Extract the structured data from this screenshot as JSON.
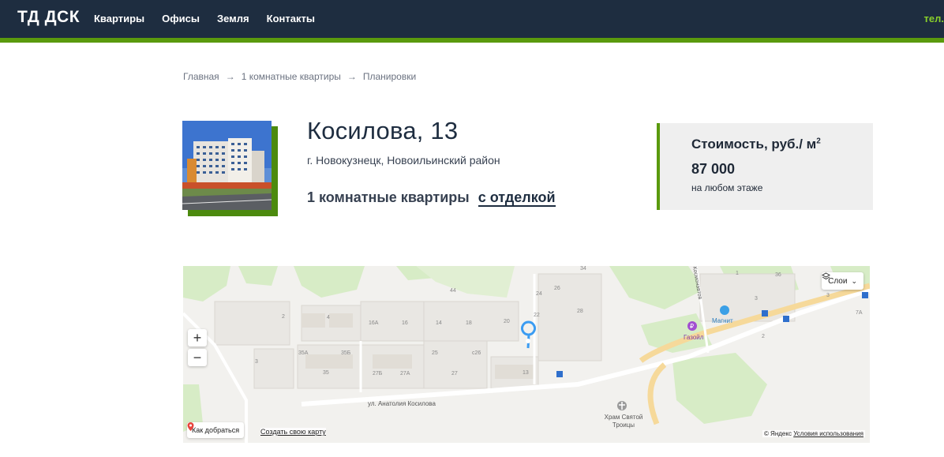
{
  "header": {
    "logo": "ТД ДСК",
    "nav": [
      "Квартиры",
      "Офисы",
      "Земля",
      "Контакты"
    ],
    "tel": "тел."
  },
  "breadcrumb": [
    "Главная",
    "1 комнатные квартиры",
    "Планировки"
  ],
  "breadcrumb_separator": "→",
  "building": {
    "title": "Косилова, 13",
    "address": "г. Новокузнецк, Новоильинский район",
    "subtitle": "1 комнатные квартиры",
    "finish_link": "с отделкой"
  },
  "price": {
    "label": "Стоимость, руб./ м",
    "label_sup": "2",
    "value": "87 000",
    "note": "на любом этаже"
  },
  "map": {
    "zoom_in": "+",
    "zoom_out": "−",
    "layers": "Слои",
    "route": "Как добраться",
    "create_map": "Создать свою карту",
    "attribution": "© Яндекс",
    "terms": "Условия использования",
    "labels": {
      "street": "ул. Анатолия Косилова",
      "gazoil": "Газойл",
      "magnit": "Магнит",
      "church": "Храм Святой Троицы",
      "kosmonavtov": "Космонавтов"
    },
    "house_numbers": [
      "44",
      "2",
      "4",
      "16А",
      "16",
      "14",
      "18",
      "20",
      "22",
      "24",
      "26",
      "28",
      "34",
      "3",
      "35А",
      "35Б",
      "25",
      "с26",
      "35",
      "27Б",
      "27А",
      "27",
      "13",
      "36",
      "3",
      "1",
      "2",
      "7А",
      "3"
    ]
  },
  "colors": {
    "header_bg": "#1e2d40",
    "accent": "#5a9a0d",
    "tel": "#8ad02a",
    "price_bg": "#efefef"
  }
}
